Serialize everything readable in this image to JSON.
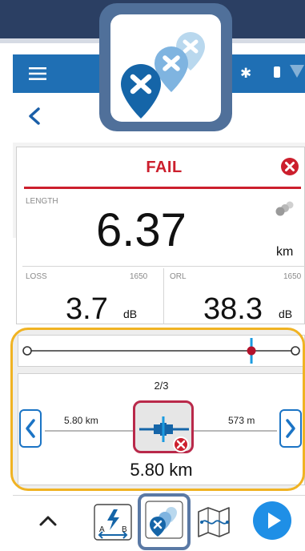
{
  "header": {
    "app_icon": "multi-pin-fail-icon"
  },
  "status_bar": {
    "menu_icon": "hamburger-menu-icon",
    "bluetooth_icon": "bluetooth-icon",
    "bluetooth_glyph": "✱",
    "battery_icon": "battery-icon",
    "signal_icon": "signal-icon"
  },
  "nav": {
    "back_icon": "back-chevron-icon"
  },
  "result": {
    "status": "FAIL",
    "status_color": "#cc1f2d",
    "length": {
      "label": "LENGTH",
      "value": "6.37",
      "unit": "km"
    },
    "loss": {
      "label": "LOSS",
      "wavelength": "1650",
      "value": "3.7",
      "unit": "dB"
    },
    "orl": {
      "label": "ORL",
      "wavelength": "1650",
      "value": "38.3",
      "unit": "dB"
    }
  },
  "event_navigator": {
    "counter": "2/3",
    "distance_left": "5.80 km",
    "distance_right": "573 m",
    "event_distance": "5.80 km",
    "slider_position": 0.84,
    "highlight_color": "#f0b323",
    "accent_color": "#1b74c5",
    "event_fail_color": "#cc1f2d"
  },
  "toolbar": {
    "items": [
      "chevron-up-icon",
      "ab-span-icon",
      "multi-pin-icon",
      "fiber-map-icon",
      "play-icon"
    ],
    "labels": {
      "a": "A",
      "b": "B"
    }
  }
}
